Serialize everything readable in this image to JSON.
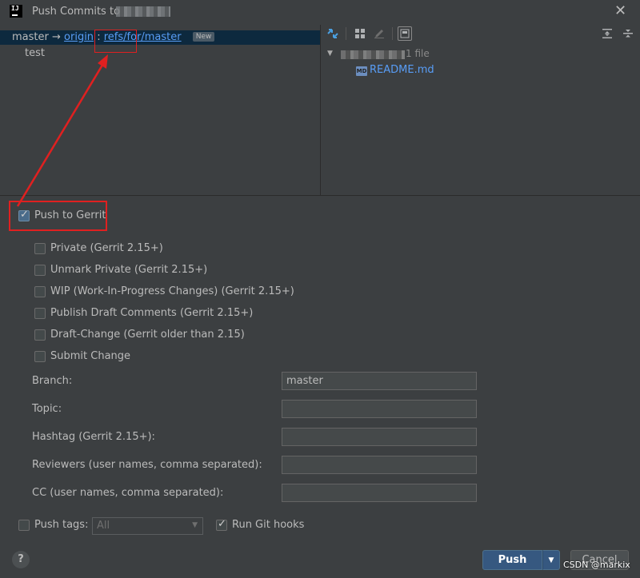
{
  "window": {
    "title": "Push Commits to",
    "app_icon_text": "IJ"
  },
  "commits": {
    "local_branch": "master",
    "arrow": "→",
    "remote": "origin",
    "separator": ":",
    "target_ref": "refs/for/master",
    "badge": "New",
    "commit_message": "test"
  },
  "changes_tree": {
    "file_count": "1 file",
    "files": [
      "README.md"
    ],
    "md_icon_text": "MD",
    "toolbar_icons": [
      "expand-diff-icon",
      "group-by-icon",
      "edit-icon",
      "preview-icon",
      "expand-all-icon",
      "collapse-all-icon"
    ]
  },
  "gerrit": {
    "push_to_gerrit_label": "Push to Gerrit",
    "push_to_gerrit_checked": true,
    "options": [
      {
        "label": "Private (Gerrit 2.15+)",
        "checked": false
      },
      {
        "label": "Unmark Private (Gerrit 2.15+)",
        "checked": false
      },
      {
        "label": "WIP (Work-In-Progress Changes) (Gerrit 2.15+)",
        "checked": false
      },
      {
        "label": "Publish Draft Comments (Gerrit 2.15+)",
        "checked": false
      },
      {
        "label": "Draft-Change (Gerrit older than 2.15)",
        "checked": false
      },
      {
        "label": "Submit Change",
        "checked": false
      }
    ],
    "fields": {
      "branch_label": "Branch:",
      "branch_value": "master",
      "topic_label": "Topic:",
      "topic_value": "",
      "hashtag_label": "Hashtag (Gerrit 2.15+):",
      "hashtag_value": "",
      "reviewers_label": "Reviewers (user names, comma separated):",
      "reviewers_value": "",
      "cc_label": "CC (user names, comma separated):",
      "cc_value": ""
    }
  },
  "footer": {
    "push_tags_label": "Push tags:",
    "push_tags_checked": false,
    "push_tags_select": "All",
    "run_git_hooks_label": "Run Git hooks",
    "run_git_hooks_checked": true,
    "help_label": "?",
    "push_label": "Push",
    "cancel_label": "Cancel",
    "watermark": "CSDN @markix"
  },
  "colors": {
    "annotation_red": "#e02020",
    "link_blue": "#589df6",
    "push_button": "#365880"
  }
}
